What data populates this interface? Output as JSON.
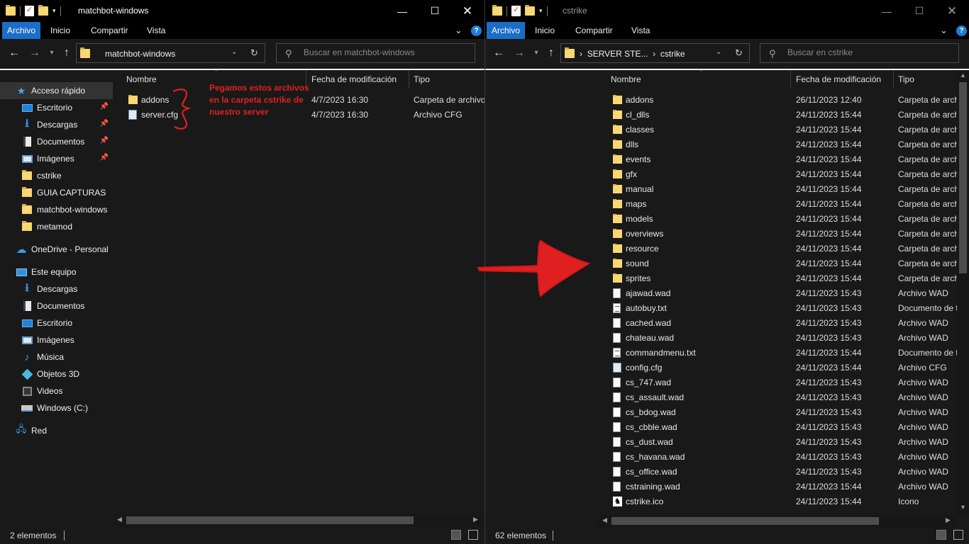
{
  "left": {
    "title": "matchbot-windows",
    "ribbon": [
      "Archivo",
      "Inicio",
      "Compartir",
      "Vista"
    ],
    "address": "matchbot-windows",
    "search_placeholder": "Buscar en matchbot-windows",
    "sidebar": [
      {
        "label": "Acceso rápido",
        "icon": "star-icon",
        "active": true
      },
      {
        "label": "Escritorio",
        "icon": "desktop-icon",
        "pinned": true
      },
      {
        "label": "Descargas",
        "icon": "download-icon",
        "pinned": true
      },
      {
        "label": "Documentos",
        "icon": "documents-icon",
        "pinned": true
      },
      {
        "label": "Imágenes",
        "icon": "pictures-icon",
        "pinned": true
      },
      {
        "label": "cstrike",
        "icon": "folder-icon"
      },
      {
        "label": "GUIA CAPTURAS",
        "icon": "folder-icon"
      },
      {
        "label": "matchbot-windows",
        "icon": "folder-icon"
      },
      {
        "label": "metamod",
        "icon": "folder-icon"
      },
      {
        "label": "OneDrive - Personal",
        "icon": "cloud-icon"
      },
      {
        "label": "Este equipo",
        "icon": "computer-icon"
      },
      {
        "label": "Descargas",
        "icon": "download-icon"
      },
      {
        "label": "Documentos",
        "icon": "documents-icon"
      },
      {
        "label": "Escritorio",
        "icon": "desktop-icon"
      },
      {
        "label": "Imágenes",
        "icon": "pictures-icon"
      },
      {
        "label": "Música",
        "icon": "music-icon"
      },
      {
        "label": "Objetos 3D",
        "icon": "3d-objects-icon"
      },
      {
        "label": "Videos",
        "icon": "video-icon"
      },
      {
        "label": "Windows (C:)",
        "icon": "drive-icon"
      },
      {
        "label": "Red",
        "icon": "network-icon"
      }
    ],
    "columns": [
      "Nombre",
      "Fecha de modificación",
      "Tipo"
    ],
    "files": [
      {
        "name": "addons",
        "date": "4/7/2023 16:30",
        "type": "Carpeta de archivos",
        "kind": "folder"
      },
      {
        "name": "server.cfg",
        "date": "4/7/2023 16:30",
        "type": "Archivo CFG",
        "kind": "cfg"
      }
    ],
    "annotation": "Pegamos estos archivos en la carpeta cstrike de nuestro server",
    "status": "2 elementos"
  },
  "right": {
    "title": "cstrike",
    "ribbon": [
      "Archivo",
      "Inicio",
      "Compartir",
      "Vista"
    ],
    "address_parent": "SERVER STE...",
    "address_current": "cstrike",
    "search_placeholder": "Buscar en cstrike",
    "columns": [
      "Nombre",
      "Fecha de modificación",
      "Tipo"
    ],
    "files": [
      {
        "name": "addons",
        "date": "26/11/2023 12:40",
        "type": "Carpeta de archivos",
        "kind": "folder"
      },
      {
        "name": "cl_dlls",
        "date": "24/11/2023 15:44",
        "type": "Carpeta de archivos",
        "kind": "folder"
      },
      {
        "name": "classes",
        "date": "24/11/2023 15:44",
        "type": "Carpeta de archivos",
        "kind": "folder"
      },
      {
        "name": "dlls",
        "date": "24/11/2023 15:44",
        "type": "Carpeta de archivos",
        "kind": "folder"
      },
      {
        "name": "events",
        "date": "24/11/2023 15:44",
        "type": "Carpeta de archivos",
        "kind": "folder"
      },
      {
        "name": "gfx",
        "date": "24/11/2023 15:44",
        "type": "Carpeta de archivos",
        "kind": "folder"
      },
      {
        "name": "manual",
        "date": "24/11/2023 15:44",
        "type": "Carpeta de archivos",
        "kind": "folder"
      },
      {
        "name": "maps",
        "date": "24/11/2023 15:44",
        "type": "Carpeta de archivos",
        "kind": "folder"
      },
      {
        "name": "models",
        "date": "24/11/2023 15:44",
        "type": "Carpeta de archivos",
        "kind": "folder"
      },
      {
        "name": "overviews",
        "date": "24/11/2023 15:44",
        "type": "Carpeta de archivos",
        "kind": "folder"
      },
      {
        "name": "resource",
        "date": "24/11/2023 15:44",
        "type": "Carpeta de archivos",
        "kind": "folder"
      },
      {
        "name": "sound",
        "date": "24/11/2023 15:44",
        "type": "Carpeta de archivos",
        "kind": "folder"
      },
      {
        "name": "sprites",
        "date": "24/11/2023 15:44",
        "type": "Carpeta de archivos",
        "kind": "folder"
      },
      {
        "name": "ajawad.wad",
        "date": "24/11/2023 15:43",
        "type": "Archivo WAD",
        "kind": "doc"
      },
      {
        "name": "autobuy.txt",
        "date": "24/11/2023 15:43",
        "type": "Documento de texto",
        "kind": "txt"
      },
      {
        "name": "cached.wad",
        "date": "24/11/2023 15:43",
        "type": "Archivo WAD",
        "kind": "doc"
      },
      {
        "name": "chateau.wad",
        "date": "24/11/2023 15:43",
        "type": "Archivo WAD",
        "kind": "doc"
      },
      {
        "name": "commandmenu.txt",
        "date": "24/11/2023 15:44",
        "type": "Documento de texto",
        "kind": "txt"
      },
      {
        "name": "config.cfg",
        "date": "24/11/2023 15:44",
        "type": "Archivo CFG",
        "kind": "cfg"
      },
      {
        "name": "cs_747.wad",
        "date": "24/11/2023 15:43",
        "type": "Archivo WAD",
        "kind": "doc"
      },
      {
        "name": "cs_assault.wad",
        "date": "24/11/2023 15:43",
        "type": "Archivo WAD",
        "kind": "doc"
      },
      {
        "name": "cs_bdog.wad",
        "date": "24/11/2023 15:43",
        "type": "Archivo WAD",
        "kind": "doc"
      },
      {
        "name": "cs_cbble.wad",
        "date": "24/11/2023 15:43",
        "type": "Archivo WAD",
        "kind": "doc"
      },
      {
        "name": "cs_dust.wad",
        "date": "24/11/2023 15:43",
        "type": "Archivo WAD",
        "kind": "doc"
      },
      {
        "name": "cs_havana.wad",
        "date": "24/11/2023 15:43",
        "type": "Archivo WAD",
        "kind": "doc"
      },
      {
        "name": "cs_office.wad",
        "date": "24/11/2023 15:43",
        "type": "Archivo WAD",
        "kind": "doc"
      },
      {
        "name": "cstraining.wad",
        "date": "24/11/2023 15:44",
        "type": "Archivo WAD",
        "kind": "doc"
      },
      {
        "name": "cstrike.ico",
        "date": "24/11/2023 15:44",
        "type": "Icono",
        "kind": "ico"
      }
    ],
    "status": "62 elementos"
  },
  "colors": {
    "accent": "#1a6ec7",
    "annotation": "#e02020",
    "arrow": "#e02020",
    "folder": "#f8d775"
  }
}
